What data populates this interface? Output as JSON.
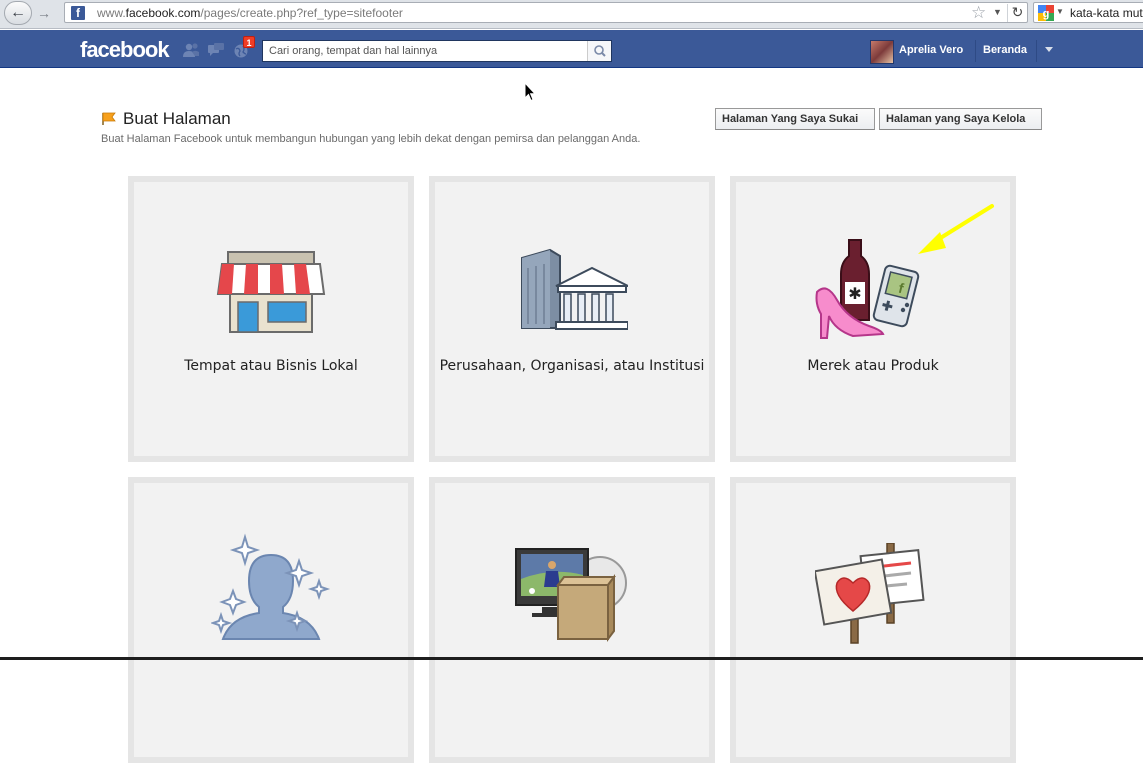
{
  "browser": {
    "url_prefix": "www.",
    "url_domain": "facebook.com",
    "url_path": "/pages/create.php?ref_type=sitefooter",
    "search_value": "kata-kata mut"
  },
  "header": {
    "logo": "facebook",
    "notif_count": "1",
    "search_placeholder": "Cari orang, tempat dan hal lainnya",
    "user_name": "Aprelia Vero",
    "home_label": "Beranda"
  },
  "page": {
    "title": "Buat Halaman",
    "subtitle": "Buat Halaman Facebook untuk membangun hubungan yang lebih dekat dengan pemirsa dan pelanggan Anda.",
    "btn_liked": "Halaman Yang Saya Sukai",
    "btn_managed": "Halaman yang Saya Kelola"
  },
  "categories": [
    {
      "label": "Tempat atau Bisnis Lokal",
      "icon": "storefront-icon"
    },
    {
      "label": "Perusahaan, Organisasi, atau Institusi",
      "icon": "building-icon"
    },
    {
      "label": "Merek atau Produk",
      "icon": "products-icon"
    },
    {
      "label": "",
      "icon": "public-figure-icon"
    },
    {
      "label": "",
      "icon": "entertainment-icon"
    },
    {
      "label": "",
      "icon": "cause-sign-icon"
    }
  ],
  "colors": {
    "fb_blue": "#3b5998",
    "card_bg": "#f2f2f2",
    "card_border": "#e5e5e5",
    "annotation_arrow": "#ffff00"
  }
}
